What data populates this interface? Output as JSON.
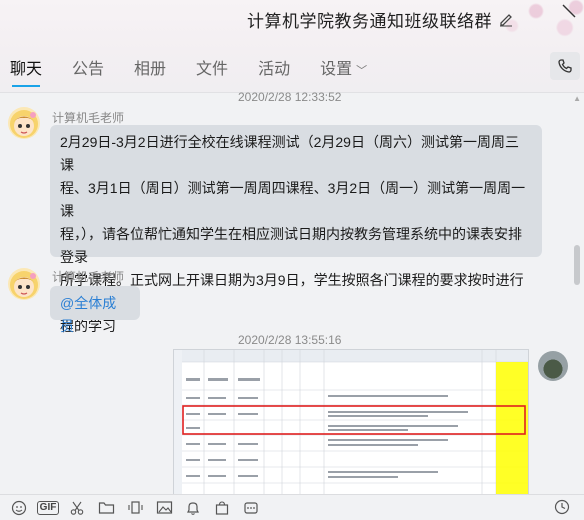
{
  "header": {
    "group_title": "计算机学院教务通知班级联络群",
    "icons": [
      "edit-icon",
      "window-control-icon",
      "phone-icon"
    ]
  },
  "tabs": [
    {
      "label": "聊天",
      "active": true
    },
    {
      "label": "公告",
      "active": false
    },
    {
      "label": "相册",
      "active": false
    },
    {
      "label": "文件",
      "active": false
    },
    {
      "label": "活动",
      "active": false
    },
    {
      "label": "设置",
      "active": false,
      "dropdown": true
    }
  ],
  "messages": [
    {
      "timestamp": "2020/2/28 12:33:52",
      "sender": "计算机毛老师",
      "lines": [
        "2月29日-3月2日进行全校在线课程测试（2月29日（周六）测试第一周周三课",
        "程、3月1日（周日）测试第一周周四课程、3月2日（周一）测试第一周周一课",
        "程，），请各位帮忙通知学生在相应测试日期内按教务管理系统中的课表安排登录",
        "所学课程。正式网上开课日期为3月9日，学生按照各门课程的要求按时进行相应课",
        "程的学习"
      ]
    },
    {
      "sender": "计算机毛老师",
      "text": "@全体成员"
    },
    {
      "timestamp": "2020/2/28 13:55:16",
      "attachment": "spreadsheet-screenshot"
    }
  ],
  "toolbar": {
    "icons": [
      "emoji-icon",
      "gif-icon",
      "scissors-icon",
      "folder-icon",
      "shake-icon",
      "image-icon",
      "bell-icon",
      "bag-icon",
      "more-icon",
      "history-icon"
    ],
    "gif_label": "GIF"
  },
  "colors": {
    "accent": "#1aa3e8",
    "bubble": "#d9dde2",
    "mention": "#2a7fd4",
    "highlight_red": "#e02020",
    "sheet_yellow": "#ffff00"
  }
}
